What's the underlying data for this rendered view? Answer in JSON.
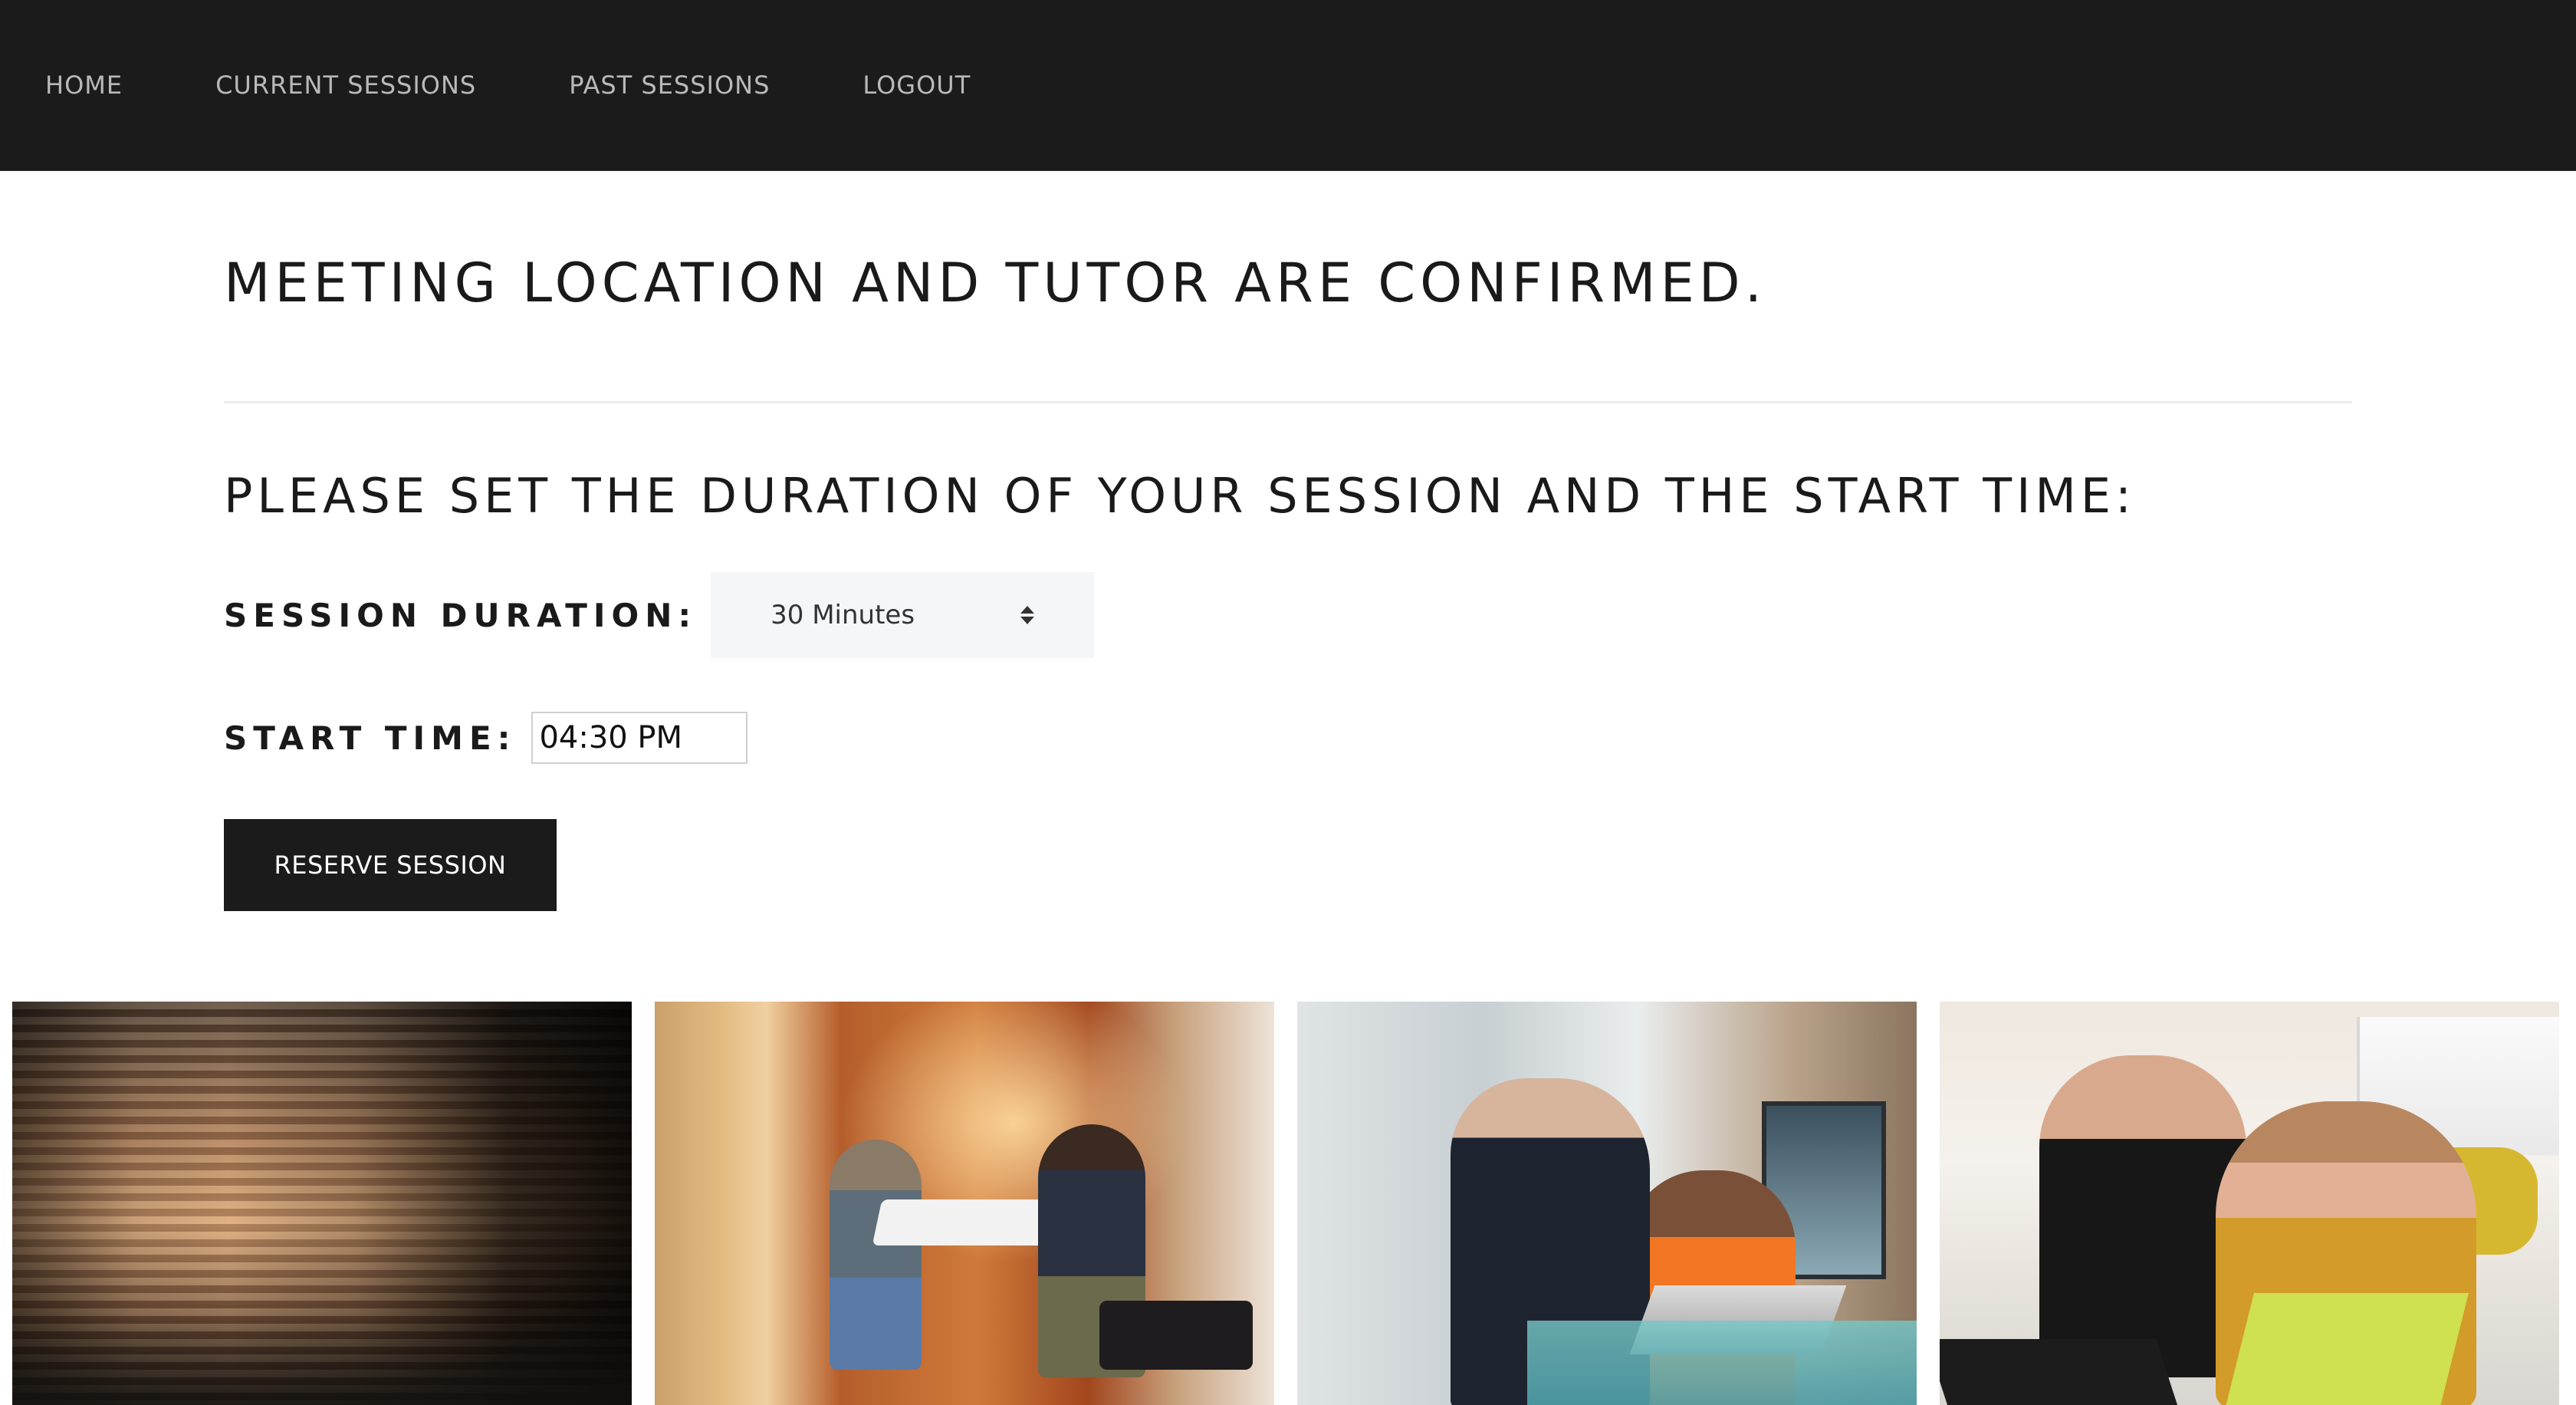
{
  "nav": {
    "items": [
      {
        "label": "HOME"
      },
      {
        "label": "CURRENT SESSIONS"
      },
      {
        "label": "PAST SESSIONS"
      },
      {
        "label": "LOGOUT"
      }
    ]
  },
  "main": {
    "confirmation_heading": "MEETING LOCATION AND TUTOR ARE CONFIRMED.",
    "prompt_heading": "PLEASE SET THE DURATION OF YOUR SESSION AND THE START TIME:",
    "duration": {
      "label": "SESSION DURATION:",
      "selected": "30 Minutes"
    },
    "start_time": {
      "label": "START TIME:",
      "value": "04:30 PM"
    },
    "reserve_button": "RESERVE SESSION"
  },
  "gallery": {
    "photos": [
      {
        "name": "cafe-interior-photo"
      },
      {
        "name": "booth-meeting-photo"
      },
      {
        "name": "office-discussion-photo"
      },
      {
        "name": "coworkers-laughing-photo"
      }
    ]
  },
  "colors": {
    "navbar_bg": "#1b1b1b",
    "nav_text": "#b9b9b9",
    "button_bg": "#1b1b1b",
    "button_text": "#ffffff",
    "select_bg": "#f5f6f7"
  }
}
